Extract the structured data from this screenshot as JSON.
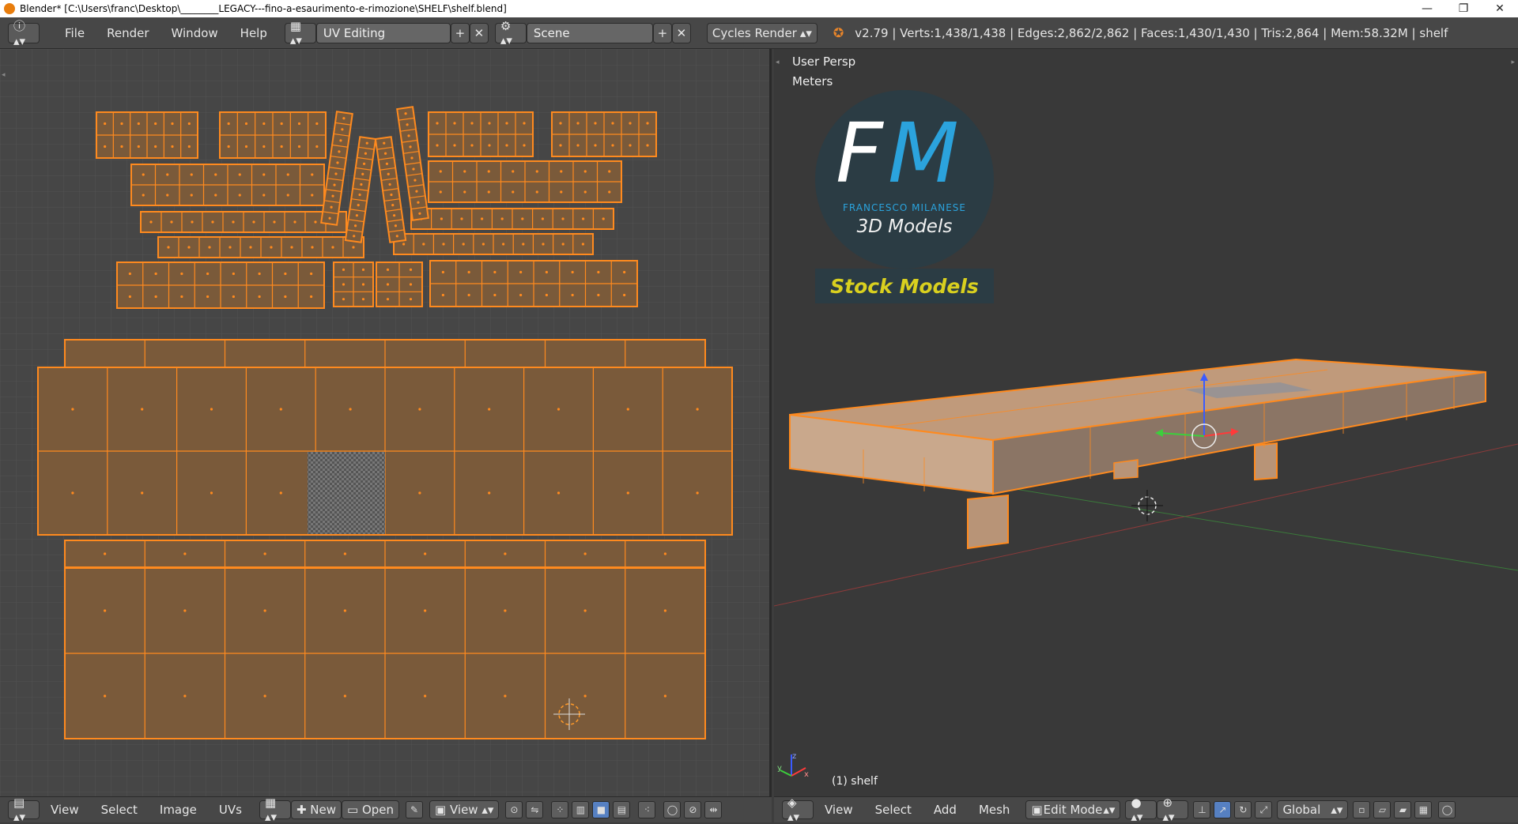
{
  "window": {
    "title": "Blender* [C:\\Users\\franc\\Desktop\\________LEGACY---fino-a-esaurimento-e-rimozione\\SHELF\\shelf.blend]",
    "controls": [
      "—",
      "❐",
      "✕"
    ]
  },
  "header": {
    "menus": [
      "File",
      "Render",
      "Window",
      "Help"
    ],
    "screen_layout": "UV Editing",
    "scene": "Scene",
    "render_engine": "Cycles Render",
    "stats": "v2.79 | Verts:1,438/1,438 | Edges:2,862/2,862 | Faces:1,430/1,430 | Tris:2,864 | Mem:58.32M | shelf"
  },
  "viewport": {
    "view_name": "User Persp",
    "units": "Meters",
    "object_label": "(1) shelf",
    "logo": {
      "initials_f": "F",
      "initials_m": "M",
      "name": "FRANCESCO MILANESE",
      "tagline": "3D Models",
      "banner": "Stock Models"
    },
    "axes": {
      "z": "z",
      "y": "y",
      "x": "x"
    }
  },
  "uv_footer": {
    "menus": [
      "View",
      "Select",
      "Image",
      "UVs"
    ],
    "new_label": "New",
    "open_label": "Open",
    "view_label": "View"
  },
  "view3d_footer": {
    "menus": [
      "View",
      "Select",
      "Add",
      "Mesh"
    ],
    "mode": "Edit Mode",
    "orientation": "Global"
  },
  "colors": {
    "uv_bg": "#464646",
    "uv_face": "#7a5a3a",
    "uv_edge": "#ff8a1e",
    "viewport_bg": "#393939",
    "logo_blue": "#2ba3dd",
    "logo_yellow": "#d9d01f"
  }
}
